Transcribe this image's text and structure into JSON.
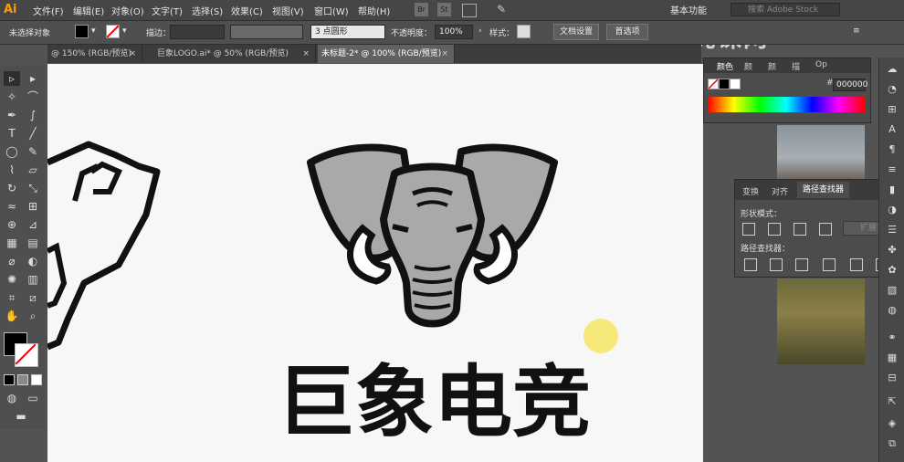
{
  "app": {
    "logo": "Ai"
  },
  "menu": [
    "文件(F)",
    "编辑(E)",
    "对象(O)",
    "文字(T)",
    "选择(S)",
    "效果(C)",
    "视图(V)",
    "窗口(W)",
    "帮助(H)"
  ],
  "menubar_icons": {
    "bridge": "Br",
    "stock": "St"
  },
  "workspace": "基本功能",
  "search_placeholder": "搜索 Adobe Stock",
  "control": {
    "selection_label": "未选择对象",
    "stroke_label": "描边：",
    "brush_label": "3 点圆形",
    "opacity_label": "不透明度：",
    "opacity_value": "100%",
    "style_label": "样式：",
    "doc_setup": "文档设置",
    "preferences": "首选项"
  },
  "tabs": [
    {
      "label": "@ 150% (RGB/预览)"
    },
    {
      "label": "巨象LOGO.ai* @ 50% (RGB/预览)"
    },
    {
      "label": "未标题-2* @ 100% (RGB/预览)"
    }
  ],
  "color_panel": {
    "tabs": [
      "颜色",
      "颜",
      "颜",
      "描",
      "Op"
    ],
    "hex": "000000",
    "hex_prefix": "#"
  },
  "path_panel": {
    "tabs": [
      "变换",
      "对齐",
      "路径查找器"
    ],
    "shape_modes": "形状模式：",
    "expand": "扩展",
    "pathfinders": "路径查找器："
  },
  "canvas": {
    "logo_text": "巨象电竞"
  },
  "watermark": "虎课网",
  "colors": {
    "accent_yellow": "#f7e87a",
    "elephant_gray": "#a9a9a9",
    "outline": "#111111"
  }
}
